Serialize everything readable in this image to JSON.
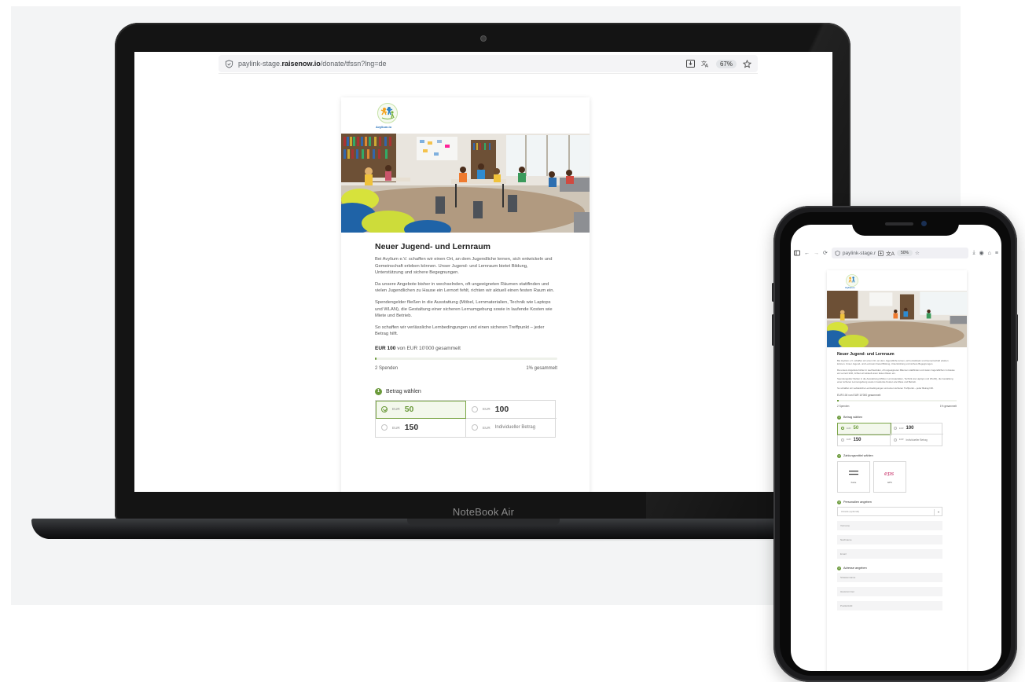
{
  "laptop": {
    "brand_label": "NoteBook Air",
    "browser": {
      "url_prefix": "paylink-stage.",
      "url_domain": "raisenow.io",
      "url_path": "/donate/tfssn?lng=de",
      "zoom": "67%"
    },
    "page": {
      "logo_text": "Avylium.io",
      "title": "Neuer Jugend- und Lernraum",
      "paragraphs": [
        "Bei Avylium e.V. schaffen wir einen Ort, an dem Jugendliche lernen, sich entwickeln und Gemeinschaft erleben können. Unser Jugend- und Lernraum bietet Bildung, Unterstützung und sichere Begegnungen.",
        "Da unsere Angebote bisher in wechselnden, oft ungeeigneten Räumen stattfinden und vielen Jugendlichen zu Hause ein Lernort fehlt, richten wir aktuell einen festen Raum ein.",
        "Spendengelder fließen in die Ausstattung (Möbel, Lernmaterialien, Technik wie Laptops und WLAN), die Gestaltung einer sicheren Lernumgebung sowie in laufende Kosten wie Miete und Betrieb.",
        "So schaffen wir verlässliche Lernbedingungen und einen sicheren Treffpunkt – jeder Betrag hilft."
      ],
      "raised_amount": "EUR 100",
      "raised_suffix": "von EUR 10'000 gesammelt",
      "progress_fraction": 0.01,
      "donations_count": "2 Spenden",
      "percent_collected": "1% gesammelt",
      "step1": {
        "number": "1",
        "label": "Betrag wählen"
      },
      "amounts": [
        {
          "currency": "EUR",
          "value": "50",
          "selected": true
        },
        {
          "currency": "EUR",
          "value": "100",
          "selected": false
        },
        {
          "currency": "EUR",
          "value": "150",
          "selected": false
        },
        {
          "currency": "EUR",
          "custom": "Individueller Betrag",
          "selected": false
        }
      ]
    }
  },
  "phone": {
    "browser": {
      "url_text": "paylink-stage.r",
      "zoom": "50%"
    },
    "page": {
      "logo_text": "Avylium.io",
      "title": "Neuer Jugend- und Lernraum",
      "paragraphs": [
        "Bei Avylium e.V. schaffen wir einen Ort, an dem Jugendliche lernen, sich entwickeln und Gemeinschaft erleben können. Unser Jugend- und Lernraum bietet Bildung, Unterstützung und sichere Begegnungen.",
        "Da unsere Angebote bisher in wechselnden, oft ungeeigneten Räumen stattfinden und vielen Jugendlichen zu Hause ein Lernort fehlt, richten wir aktuell einen festen Raum ein.",
        "Spendengelder fließen in die Ausstattung (Möbel, Lernmaterialien, Technik wie Laptops und WLAN), die Gestaltung einer sicheren Lernumgebung sowie in laufende Kosten wie Miete und Betrieb.",
        "So schaffen wir verlässliche Lernbedingungen und einen sicheren Treffpunkt – jeder Betrag hilft."
      ],
      "raised_line": "EUR 100 von EUR 10'000 gesammelt",
      "donations_count": "2 Spenden",
      "percent_collected": "1% gesammelt",
      "step1": {
        "number": "1",
        "label": "Betrag wählen"
      },
      "amounts": [
        {
          "currency": "EUR",
          "value": "50",
          "selected": true
        },
        {
          "currency": "EUR",
          "value": "100",
          "selected": false
        },
        {
          "currency": "EUR",
          "value": "150",
          "selected": false
        },
        {
          "currency": "EUR",
          "custom": "Individueller Betrag",
          "selected": false
        }
      ],
      "step2": {
        "number": "2",
        "label": "Zahlungsmittel wählen"
      },
      "payment_methods": [
        {
          "label": "Karte",
          "icon": "card-icon"
        },
        {
          "label": "EPS",
          "icon": "eps-logo"
        }
      ],
      "step3": {
        "number": "3",
        "label": "Personalien angeben"
      },
      "personal_fields": {
        "salutation": "Anrede (optional)",
        "first_name": "Vorname",
        "last_name": "Nachname",
        "email": "Email"
      },
      "step4": {
        "number": "4",
        "label": "Adresse angeben"
      },
      "address_fields": {
        "street": "Strassenname",
        "house_number": "Hausnummer",
        "postal_code": "Postleitzahl"
      }
    }
  },
  "colors": {
    "accent_green": "#6b9a3b",
    "device_dark": "#141414"
  }
}
